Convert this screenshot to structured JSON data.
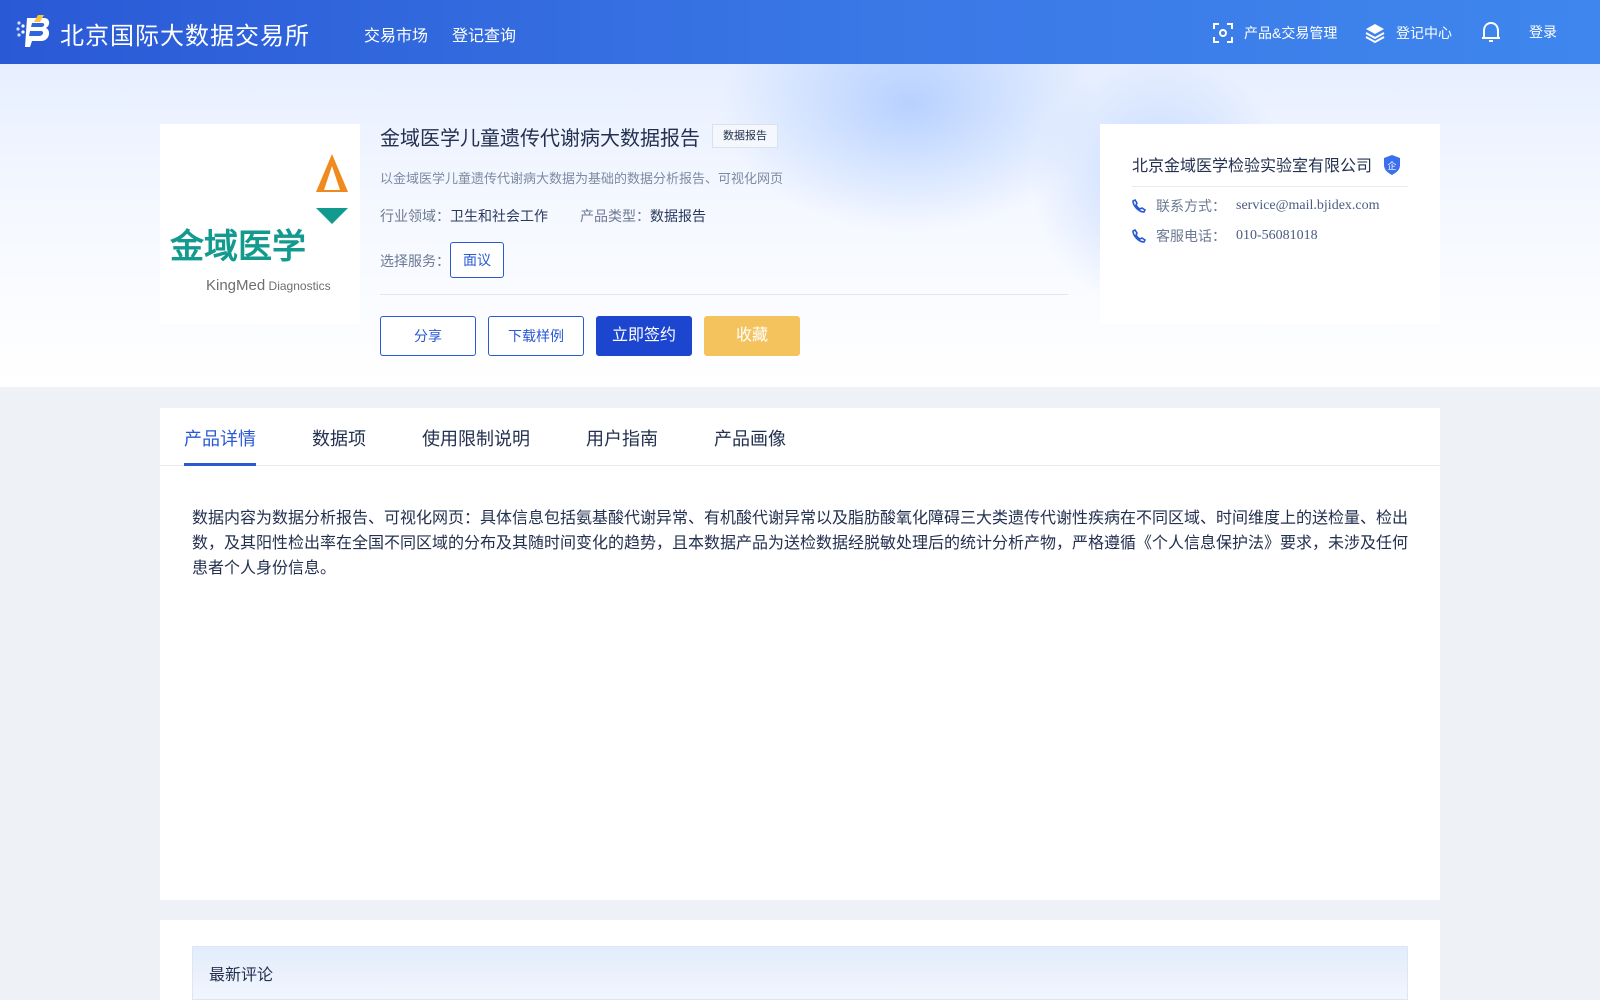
{
  "header": {
    "brand": "北京国际大数据交易所",
    "nav": [
      "交易市场",
      "登记查询"
    ],
    "right": {
      "product_mgmt": "产品&交易管理",
      "register_center": "登记中心",
      "login": "登录"
    }
  },
  "product": {
    "title": "金域医学儿童遗传代谢病大数据报告",
    "tag": "数据报告",
    "description": "以金域医学儿童遗传代谢病大数据为基础的数据分析报告、可视化网页",
    "industry_label": "行业领域：",
    "industry_value": "卫生和社会工作",
    "type_label": "产品类型：",
    "type_value": "数据报告",
    "service_label": "选择服务：",
    "service_option": "面议",
    "logo": {
      "cn": "金域医学",
      "en_bold": "KingMed",
      "en_light": " Diagnostics"
    },
    "buttons": {
      "share": "分享",
      "download_sample": "下载样例",
      "sign_now": "立即签约",
      "favorite": "收藏"
    }
  },
  "company": {
    "name": "北京金域医学检验实验室有限公司",
    "badge": "企",
    "contact_label": "联系方式：",
    "contact_value": "service@mail.bjidex.com",
    "phone_label": "客服电话：",
    "phone_value": "010-56081018"
  },
  "tabs": [
    "产品详情",
    "数据项",
    "使用限制说明",
    "用户指南",
    "产品画像"
  ],
  "active_tab": 0,
  "detail_text": "数据内容为数据分析报告、可视化网页：具体信息包括氨基酸代谢异常、有机酸代谢异常以及脂肪酸氧化障碍三大类遗传代谢性疾病在不同区域、时间维度上的送检量、检出数，及其阳性检出率在全国不同区域的分布及其随时间变化的趋势，且本数据产品为送检数据经脱敏处理后的统计分析产物，严格遵循《个人信息保护法》要求，未涉及任何患者个人身份信息。",
  "comments": {
    "title": "最新评论"
  },
  "colors": {
    "primary": "#2a59d6",
    "sign_button": "#1d46d0",
    "favorite_button": "#f4c35e",
    "logo_teal": "#139a8e",
    "logo_orange": "#f08a1c"
  }
}
